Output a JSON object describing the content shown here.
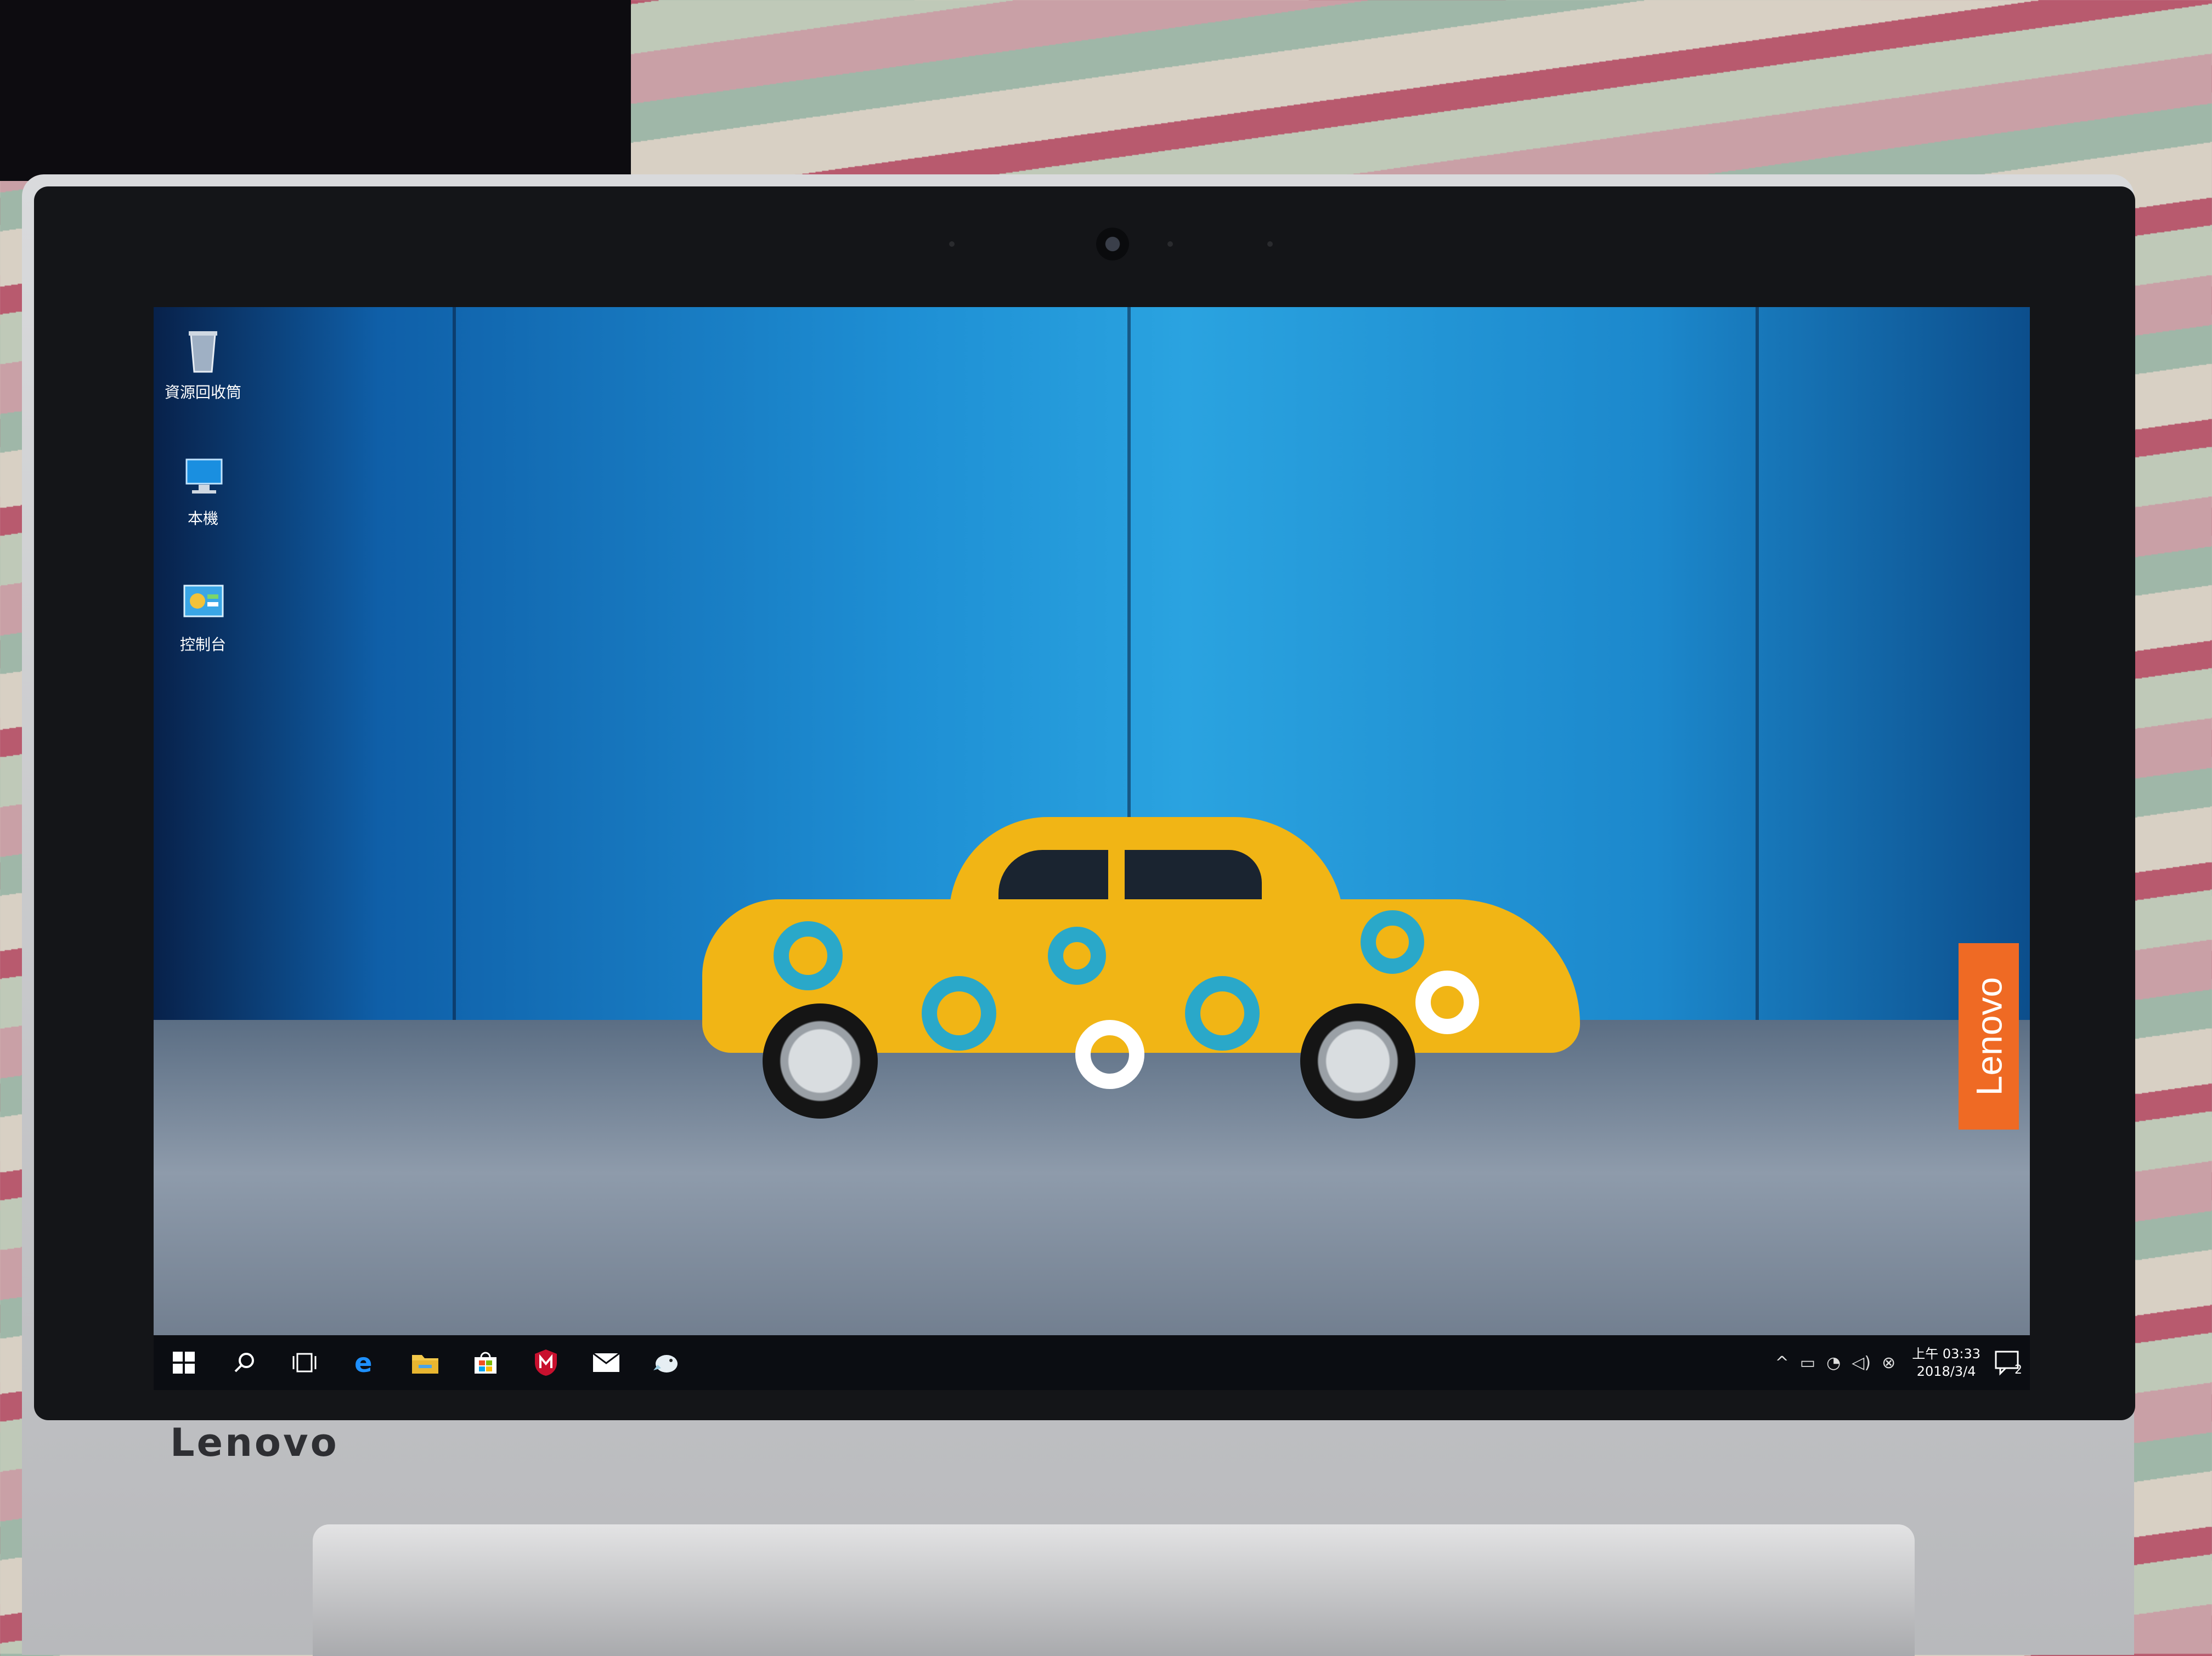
{
  "bezel": {
    "brand": "Lenovo"
  },
  "wallpaper": {
    "brand_tag": "Lenovo"
  },
  "desktop_icons": [
    {
      "label": "資源回收筒",
      "icon": "recycle-bin-icon"
    },
    {
      "label": "本機",
      "icon": "this-pc-icon"
    },
    {
      "label": "控制台",
      "icon": "control-panel-icon"
    }
  ],
  "taskbar": {
    "apps": [
      "start-icon",
      "search-icon",
      "task-view-icon",
      "edge-icon",
      "file-explorer-icon",
      "store-icon",
      "mcafee-icon",
      "mail-icon",
      "bird-app-icon"
    ]
  },
  "tray": {
    "time": "上午 03:33",
    "date": "2018/3/4",
    "notification_count": "2"
  },
  "colors": {
    "taskbar": "#0b0d12",
    "car_yellow": "#f1b515",
    "ring_teal": "#2aa8c9",
    "lenovo_orange": "#ef6a24"
  }
}
